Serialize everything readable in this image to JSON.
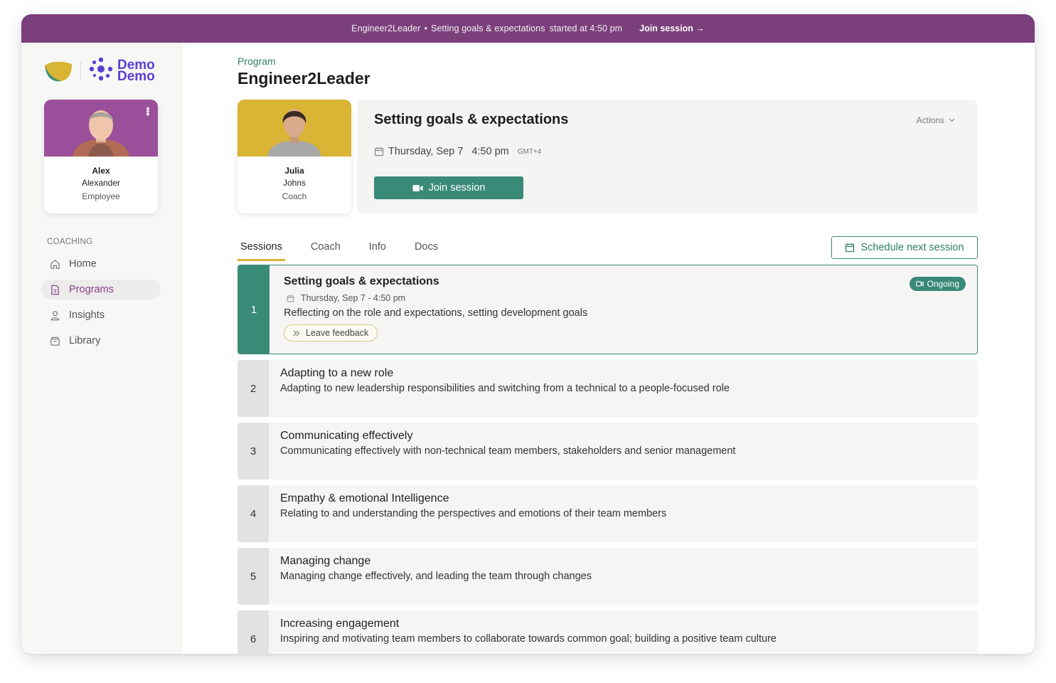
{
  "banner": {
    "program": "Engineer2Leader",
    "separator": "•",
    "session": "Setting goals & expectations",
    "started": "started at 4:50 pm",
    "join_label": "Join session →"
  },
  "brand": {
    "client_line1": "Demo",
    "client_line2": "Demo"
  },
  "profile": {
    "first_name": "Alex",
    "last_name": "Alexander",
    "role": "Employee"
  },
  "nav": {
    "section_label": "COACHING",
    "items": [
      {
        "label": "Home",
        "icon": "home-icon"
      },
      {
        "label": "Programs",
        "icon": "document-icon"
      },
      {
        "label": "Insights",
        "icon": "person-icon"
      },
      {
        "label": "Library",
        "icon": "archive-icon"
      }
    ],
    "active": "Programs"
  },
  "header": {
    "breadcrumb": "Program",
    "title": "Engineer2Leader"
  },
  "coach": {
    "first_name": "Julia",
    "last_name": "Johns",
    "role": "Coach"
  },
  "current_session": {
    "title": "Setting goals & expectations",
    "actions_label": "Actions",
    "date": "Thursday, Sep 7",
    "time": "4:50 pm",
    "timezone": "GMT+4",
    "join_label": "Join session"
  },
  "tabs": {
    "items": [
      "Sessions",
      "Coach",
      "Info",
      "Docs"
    ],
    "active": "Sessions"
  },
  "schedule_label": "Schedule next session",
  "sessions": [
    {
      "number": "1",
      "title": "Setting goals & expectations",
      "datetime": "Thursday, Sep 7  - 4:50 pm",
      "description": "Reflecting on the role and expectations, setting development goals",
      "status": "Ongoing",
      "feedback_label": "Leave feedback"
    },
    {
      "number": "2",
      "title": "Adapting to a new role",
      "description": "Adapting to new leadership responsibilities and switching from a technical to a people-focused role"
    },
    {
      "number": "3",
      "title": "Communicating effectively",
      "description": "Communicating effectively with non-technical team members, stakeholders and senior management"
    },
    {
      "number": "4",
      "title": "Empathy & emotional Intelligence",
      "description": "Relating to and understanding the perspectives and emotions of their team members"
    },
    {
      "number": "5",
      "title": "Managing change",
      "description": "Managing change effectively, and leading the team through changes"
    },
    {
      "number": "6",
      "title": "Increasing engagement",
      "description": "Inspiring and motivating team members to collaborate towards common goal; building a positive team culture"
    }
  ],
  "colors": {
    "banner": "#7b3f7b",
    "accent_green": "#3a8a78",
    "accent_purple": "#8a3f8a",
    "tab_underline": "#d9b435",
    "brand_blue": "#5a3fd6"
  }
}
